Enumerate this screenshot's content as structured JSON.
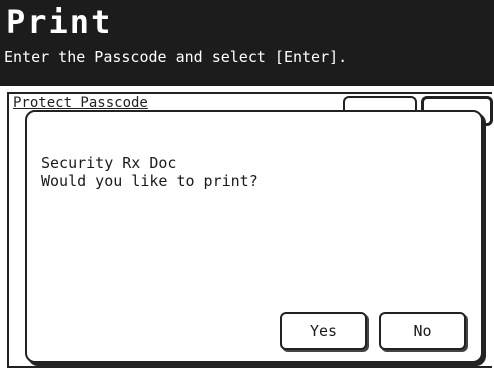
{
  "header": {
    "title": "Print",
    "subtitle": "Enter the Passcode and select [Enter]."
  },
  "background_panel": {
    "field_label": "Protect Passcode"
  },
  "dialog": {
    "line1": "Security Rx Doc",
    "line2": "Would you like to print?",
    "yes_label": "Yes",
    "no_label": "No"
  },
  "colors": {
    "header_bg": "#1c1c1c",
    "header_text": "#ffffff",
    "border": "#222222"
  }
}
